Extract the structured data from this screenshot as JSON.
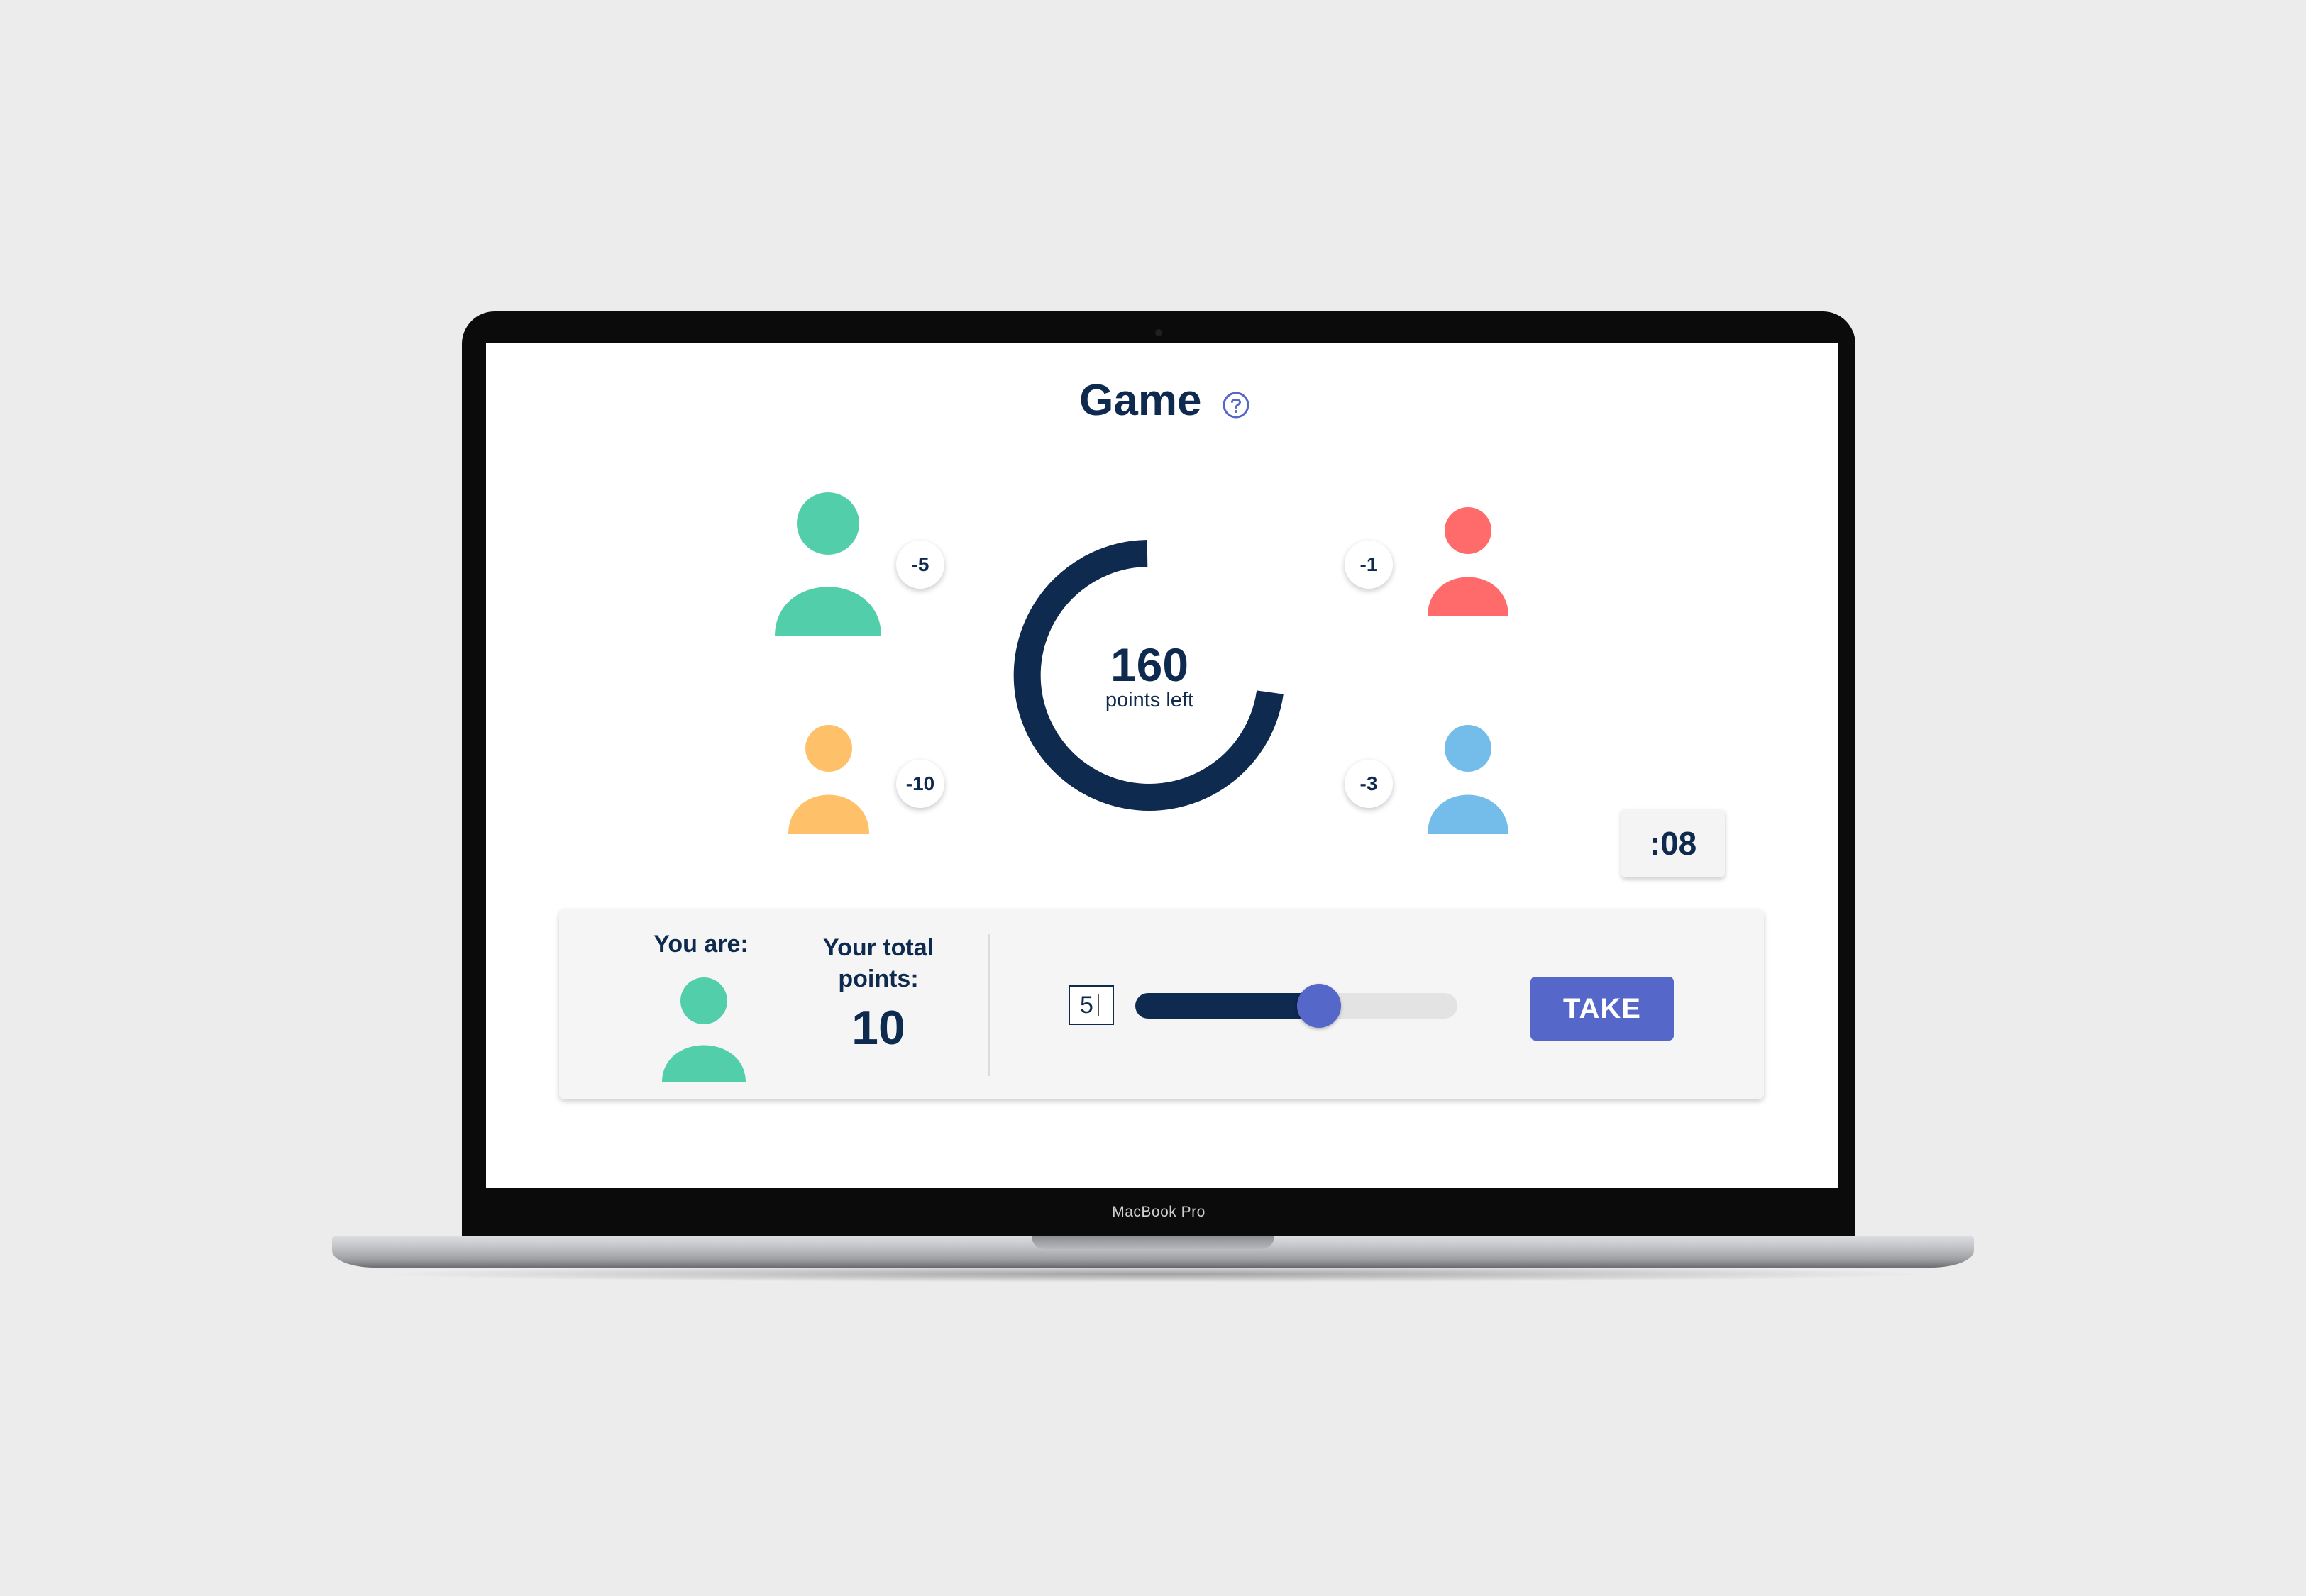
{
  "device": {
    "brand_label": "MacBook Pro"
  },
  "header": {
    "title": "Game",
    "help_icon": "question-circle-icon"
  },
  "players": [
    {
      "color": "#52cfaa",
      "delta": "-5"
    },
    {
      "color": "#ff6b6b",
      "delta": "-1"
    },
    {
      "color": "#ffc06a",
      "delta": "-10"
    },
    {
      "color": "#74bdea",
      "delta": "-3"
    }
  ],
  "pool": {
    "value": "160",
    "label": "points left",
    "ring_color": "#0f2a4f"
  },
  "timer": {
    "value": ":08"
  },
  "panel": {
    "you_are_label": "You are:",
    "you_color": "#52cfaa",
    "total_points_label": "Your total points:",
    "total_points_value": "10",
    "amount_value": "5",
    "slider_fraction": 0.57,
    "take_label": "TAKE"
  },
  "colors": {
    "accent": "#5568c9",
    "navy": "#0f2a4f"
  }
}
